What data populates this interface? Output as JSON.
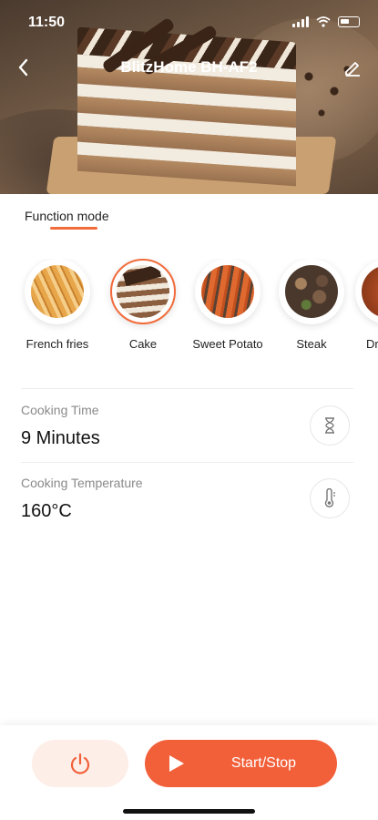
{
  "status_bar": {
    "time": "11:50"
  },
  "header": {
    "title": "BlitzHome BH-AF2"
  },
  "tabs": [
    {
      "label": "Function mode"
    }
  ],
  "modes": [
    {
      "label": "French fries"
    },
    {
      "label": "Cake"
    },
    {
      "label": "Sweet Potato"
    },
    {
      "label": "Steak"
    },
    {
      "label": "Dr"
    }
  ],
  "selected_mode": "Cake",
  "settings": {
    "time": {
      "label": "Cooking Time",
      "value": "9 Minutes",
      "icon": "hourglass-icon"
    },
    "temperature": {
      "label": "Cooking Temperature",
      "value": "160°C",
      "icon": "thermometer-icon"
    }
  },
  "actions": {
    "start_label": "Start/Stop"
  },
  "colors": {
    "accent": "#f2603a",
    "power_bg": "#fdeee8"
  }
}
